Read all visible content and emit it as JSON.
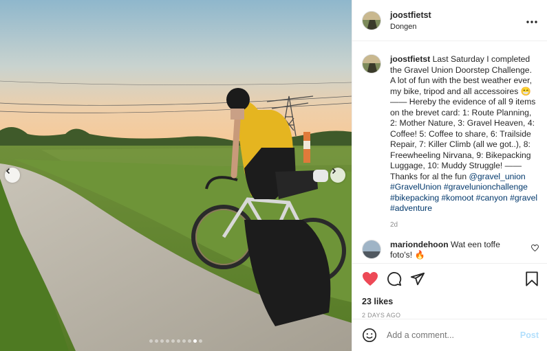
{
  "post": {
    "username": "joostfietst",
    "location": "Dongen",
    "more_icon": "more-horizontal-icon",
    "carousel": {
      "count": 10,
      "active_index": 8
    }
  },
  "caption": {
    "username": "joostfietst",
    "text_part1": "Last Saturday I completed the Gravel Union Doorstep Challenge. A lot of fun with the best weather ever, my bike, tripod and all accessoires 😁 —— Hereby the evidence of all 9 items on the brevet card: 1: Route Planning, 2: Mother Nature, 3: Gravel Heaven, 4: Coffee! 5: Coffee to share, 6: Trailside Repair, 7: Killer Climb (all we got..), 8: Freewheeling Nirvana, 9: Bikepacking Luggage, 10: Muddy Struggle! —— Thanks for al the fun ",
    "mention": "@gravel_union",
    "hashtags": "#GravelUnion #gravelunionchallenge #bikepacking #komoot #canyon #gravel #adventure",
    "age": "2d"
  },
  "reply": {
    "username": "mariondehoon",
    "text": "Wat een toffe foto's! 🔥"
  },
  "actions": {
    "likes": "23 likes",
    "date": "2 DAYS AGO",
    "liked_color": "#ed4956"
  },
  "comment_box": {
    "placeholder": "Add a comment...",
    "post_label": "Post"
  }
}
